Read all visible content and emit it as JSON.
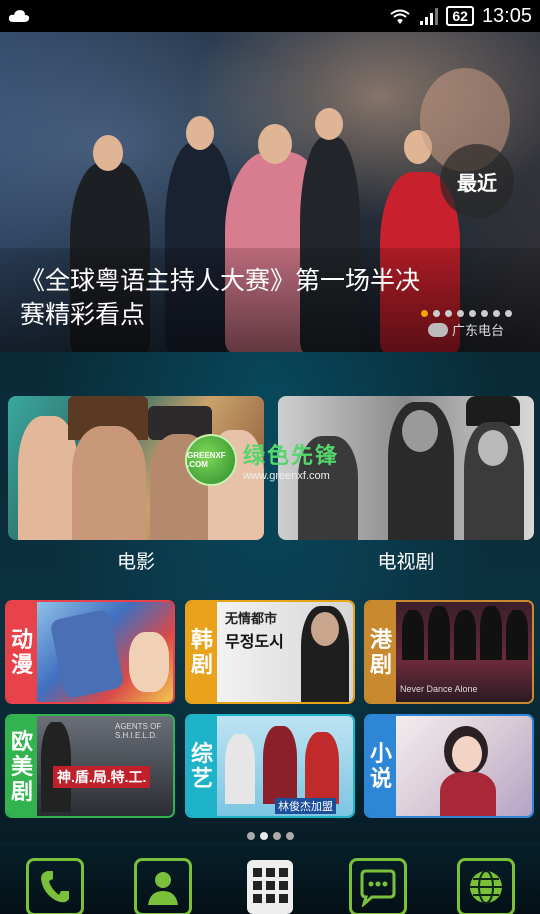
{
  "status_bar": {
    "battery": "62",
    "time": "13:05"
  },
  "banner": {
    "title": "《全球粤语主持人大赛》第一场半决赛精彩看点",
    "recent_button": "最近",
    "source": "广东电台",
    "dots_total": 8,
    "dots_active": 1
  },
  "featured": {
    "movie_label": "电影",
    "tv_label": "电视剧"
  },
  "categories": [
    {
      "label": "动漫",
      "color": "#e8424a"
    },
    {
      "label": "韩剧",
      "color": "#e9a21b"
    },
    {
      "label": "港剧",
      "color": "#c98a2f"
    },
    {
      "label": "欧美剧",
      "color": "#33b34f"
    },
    {
      "label": "综艺",
      "color": "#1fb3c9"
    },
    {
      "label": "小说",
      "color": "#2e86d6"
    }
  ],
  "card_texts": {
    "korean_poster_title": "无情都市",
    "korean_poster_sub": "무정도시",
    "shield_title": "神.盾.局.特.工.",
    "shield_sub": "AGENTS OF S.H.I.E.L.D.",
    "variety_tag": "林俊杰加盟",
    "hk_poster": "Never Dance Alone"
  },
  "watermark": {
    "logo": "GREENXF .COM",
    "text": "绿色先锋",
    "url": "www.greenxf.com"
  },
  "dock": [
    "phone-icon",
    "contacts-icon",
    "apps-grid-icon",
    "messages-icon",
    "browser-globe-icon"
  ],
  "colors": {
    "dock_border": "#7bc03a",
    "dot_active": "#f5a500"
  }
}
